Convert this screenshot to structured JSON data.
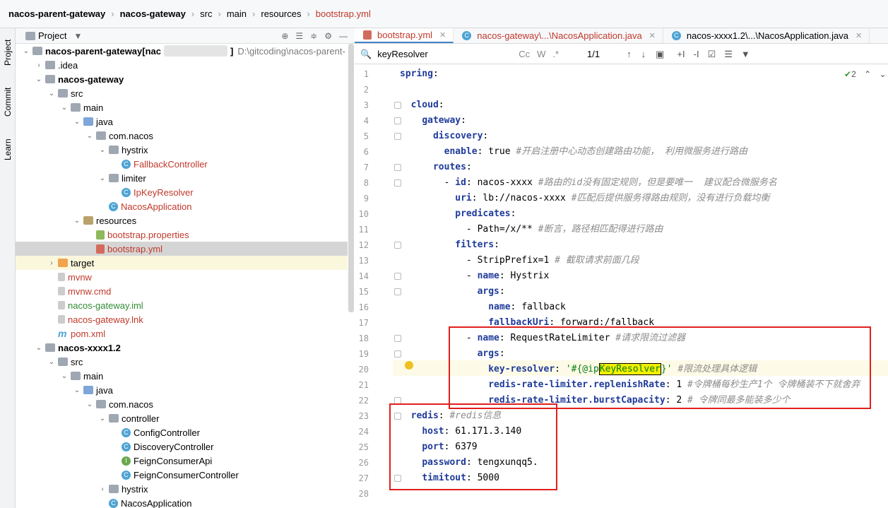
{
  "breadcrumbs": [
    "nacos-parent-gateway",
    "nacos-gateway",
    "src",
    "main",
    "resources",
    "bootstrap.yml"
  ],
  "sidebar_tabs": [
    "Project",
    "Commit",
    "Learn"
  ],
  "project_header": {
    "title": "Project"
  },
  "tree": [
    {
      "label": "nacos-parent-gateway",
      "suffix": " [nac",
      "path": "D:\\gitcoding\\nacos-parent-",
      "bold": true,
      "depth": 0,
      "open": true,
      "icon": "folder"
    },
    {
      "label": ".idea",
      "depth": 1,
      "open": false,
      "icon": "folder"
    },
    {
      "label": "nacos-gateway",
      "bold": true,
      "depth": 1,
      "open": true,
      "icon": "folder"
    },
    {
      "label": "src",
      "depth": 2,
      "open": true,
      "icon": "folder"
    },
    {
      "label": "main",
      "depth": 3,
      "open": true,
      "icon": "folder"
    },
    {
      "label": "java",
      "depth": 4,
      "open": true,
      "icon": "src"
    },
    {
      "label": "com.nacos",
      "depth": 5,
      "open": true,
      "icon": "folder"
    },
    {
      "label": "hystrix",
      "depth": 6,
      "open": true,
      "icon": "folder"
    },
    {
      "label": "FallbackController",
      "depth": 7,
      "icon": "cls",
      "color": "r"
    },
    {
      "label": "limiter",
      "depth": 6,
      "open": true,
      "icon": "folder"
    },
    {
      "label": "IpKeyResolver",
      "depth": 7,
      "icon": "cls",
      "color": "r"
    },
    {
      "label": "NacosApplication",
      "depth": 6,
      "icon": "cls",
      "color": "r"
    },
    {
      "label": "resources",
      "depth": 4,
      "open": true,
      "icon": "res"
    },
    {
      "label": "bootstrap.properties",
      "depth": 5,
      "icon": "prop",
      "color": "r"
    },
    {
      "label": "bootstrap.yml",
      "depth": 5,
      "icon": "yml",
      "color": "r",
      "selected": true
    },
    {
      "label": "target",
      "depth": 2,
      "open": false,
      "icon": "tgtf",
      "target": true
    },
    {
      "label": "mvnw",
      "depth": 2,
      "icon": "file",
      "color": "r"
    },
    {
      "label": "mvnw.cmd",
      "depth": 2,
      "icon": "file",
      "color": "r"
    },
    {
      "label": "nacos-gateway.iml",
      "depth": 2,
      "icon": "file",
      "color": "g"
    },
    {
      "label": "nacos-gateway.lnk",
      "depth": 2,
      "icon": "file",
      "color": "r"
    },
    {
      "label": "pom.xml",
      "depth": 2,
      "icon": "pom",
      "color": "r"
    },
    {
      "label": "nacos-xxxx1.2",
      "bold": true,
      "depth": 1,
      "open": true,
      "icon": "folder"
    },
    {
      "label": "src",
      "depth": 2,
      "open": true,
      "icon": "folder"
    },
    {
      "label": "main",
      "depth": 3,
      "open": true,
      "icon": "folder"
    },
    {
      "label": "java",
      "depth": 4,
      "open": true,
      "icon": "src"
    },
    {
      "label": "com.nacos",
      "depth": 5,
      "open": true,
      "icon": "folder"
    },
    {
      "label": "controller",
      "depth": 6,
      "open": true,
      "icon": "folder"
    },
    {
      "label": "ConfigController",
      "depth": 7,
      "icon": "cls"
    },
    {
      "label": "DiscoveryController",
      "depth": 7,
      "icon": "cls"
    },
    {
      "label": "FeignConsumerApi",
      "depth": 7,
      "icon": "intf"
    },
    {
      "label": "FeignConsumerController",
      "depth": 7,
      "icon": "cls"
    },
    {
      "label": "hystrix",
      "depth": 6,
      "open": false,
      "icon": "folder"
    },
    {
      "label": "NacosApplication",
      "depth": 6,
      "icon": "cls"
    }
  ],
  "tabs": [
    {
      "label": "bootstrap.yml",
      "active": true,
      "color": "r"
    },
    {
      "label": "nacos-gateway\\...\\NacosApplication.java",
      "color": "r"
    },
    {
      "label": "nacos-xxxx1.2\\...\\NacosApplication.java"
    }
  ],
  "find": {
    "query": "keyResolver",
    "count": "1/1",
    "cc": "Cc",
    "w": "W",
    "regex": ".*"
  },
  "inspections": {
    "count": "2"
  },
  "code_lines": [
    {
      "n": "1",
      "html": "<span class='k'>spring</span>:"
    },
    {
      "n": "2",
      "html": ""
    },
    {
      "n": "3",
      "html": "  <span class='k'>cloud</span>:"
    },
    {
      "n": "4",
      "html": "    <span class='k'>gateway</span>:"
    },
    {
      "n": "5",
      "html": "      <span class='k'>discovery</span>:"
    },
    {
      "n": "6",
      "html": "        <span class='k'>enable</span>: true <span class='cm'>#开启注册中心动态创建路由功能， 利用微服务进行路由</span>"
    },
    {
      "n": "7",
      "html": "      <span class='k'>routes</span>:"
    },
    {
      "n": "8",
      "html": "        - <span class='k'>id</span>: nacos-xxxx <span class='cm'>#路由的id没有固定规则，但是要唯一  建议配合微服务名</span>"
    },
    {
      "n": "9",
      "html": "          <span class='k'>uri</span>: lb://nacos-xxxx <span class='cm'>#匹配后提供服务得路由规则，没有进行负载均衡</span>"
    },
    {
      "n": "10",
      "html": "          <span class='k'>predicates</span>:"
    },
    {
      "n": "11",
      "html": "            - Path=/x/** <span class='cm'>#断言，路径相匹配得进行路由</span>"
    },
    {
      "n": "12",
      "html": "          <span class='k'>filters</span>:"
    },
    {
      "n": "13",
      "html": "            - StripPrefix=1 <span class='cm'># 截取请求前面几段</span>"
    },
    {
      "n": "14",
      "html": "            - <span class='k'>name</span>: Hystrix"
    },
    {
      "n": "15",
      "html": "              <span class='k'>args</span>:"
    },
    {
      "n": "16",
      "html": "                <span class='k'>name</span>: fallback"
    },
    {
      "n": "17",
      "html": "                <span class='k'>fallbackUri</span>: forward:/fallback"
    },
    {
      "n": "18",
      "html": "            - <span class='k'>name</span>: RequestRateLimiter <span class='cm'>#请求限流过滤器</span>"
    },
    {
      "n": "19",
      "html": "              <span class='k'>args</span>:"
    },
    {
      "n": "20",
      "html": "                <span class='k'>key-resolver</span>: <span class='st'>'#{@ip<span class='hlw'>KeyResolver</span>}'</span> <span class='cm'>#限流处理具体逻辑</span>"
    },
    {
      "n": "21",
      "html": "                <span class='k'>redis-rate-limiter.replenishRate</span>: 1 <span class='cm'>#令牌桶每秒生产1个 令牌桶装不下就舍弃</span>"
    },
    {
      "n": "22",
      "html": "                <span class='k'>redis-rate-limiter.burstCapacity</span>: 2 <span class='cm'># 令牌同最多能装多少个</span>"
    },
    {
      "n": "23",
      "html": "  <span class='k'>redis</span>: <span class='cm'>#redis信息</span>"
    },
    {
      "n": "24",
      "html": "    <span class='k'>host</span>: 61.171.3.140"
    },
    {
      "n": "25",
      "html": "    <span class='k'>port</span>: 6379"
    },
    {
      "n": "26",
      "html": "    <span class='k'>password</span>: tengxunqq5."
    },
    {
      "n": "27",
      "html": "    <span class='k'>timitout</span>: 5000"
    },
    {
      "n": "28",
      "html": ""
    }
  ]
}
